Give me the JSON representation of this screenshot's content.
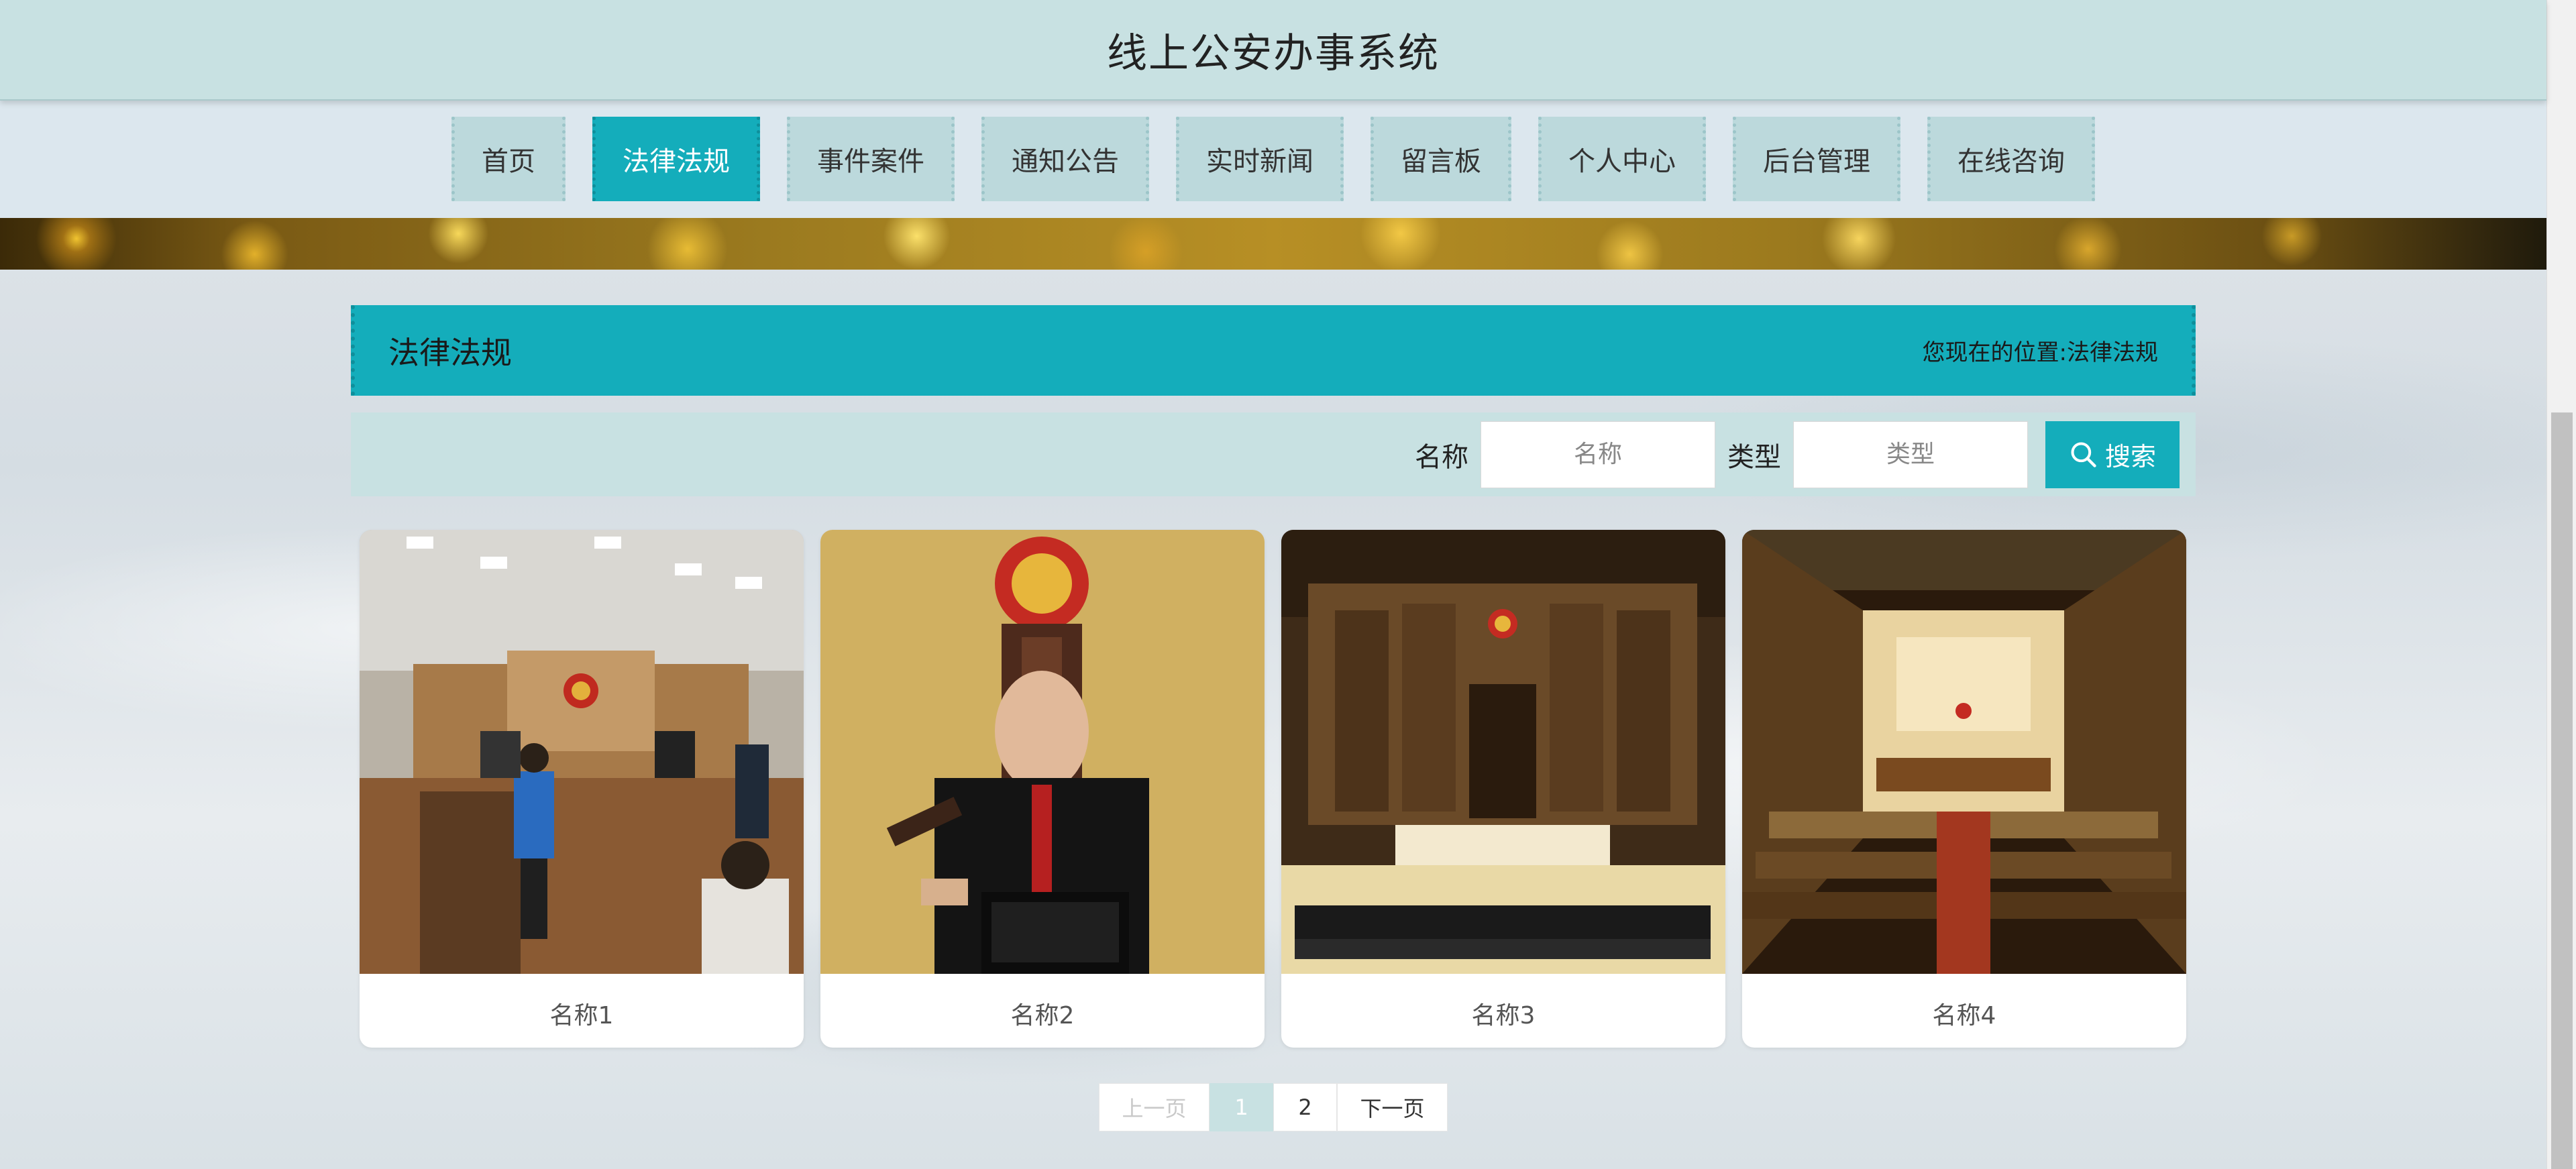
{
  "header": {
    "site_title": "线上公安办事系统"
  },
  "nav": {
    "items": [
      {
        "label": "首页",
        "active": false
      },
      {
        "label": "法律法规",
        "active": true
      },
      {
        "label": "事件案件",
        "active": false
      },
      {
        "label": "通知公告",
        "active": false
      },
      {
        "label": "实时新闻",
        "active": false
      },
      {
        "label": "留言板",
        "active": false
      },
      {
        "label": "个人中心",
        "active": false
      },
      {
        "label": "后台管理",
        "active": false
      },
      {
        "label": "在线咨询",
        "active": false
      }
    ]
  },
  "section": {
    "title": "法律法规",
    "breadcrumb_prefix": "您现在的位置:",
    "breadcrumb_current": "法律法规"
  },
  "search": {
    "name_label": "名称",
    "name_placeholder": "名称",
    "type_label": "类型",
    "type_placeholder": "类型",
    "button_label": "搜索"
  },
  "cards": [
    {
      "name": "名称1",
      "image": "courtroom-trial-photo"
    },
    {
      "name": "名称2",
      "image": "judge-with-gavel-photo"
    },
    {
      "name": "名称3",
      "image": "courtroom-hall-photo"
    },
    {
      "name": "名称4",
      "image": "courtroom-interior-photo"
    }
  ],
  "pagination": {
    "prev_label": "上一页",
    "pages": [
      "1",
      "2"
    ],
    "current_page": "1",
    "next_label": "下一页"
  },
  "colors": {
    "accent": "#14adbb",
    "header_bg": "#c8e1e2",
    "nav_bg": "#dce7ee"
  }
}
